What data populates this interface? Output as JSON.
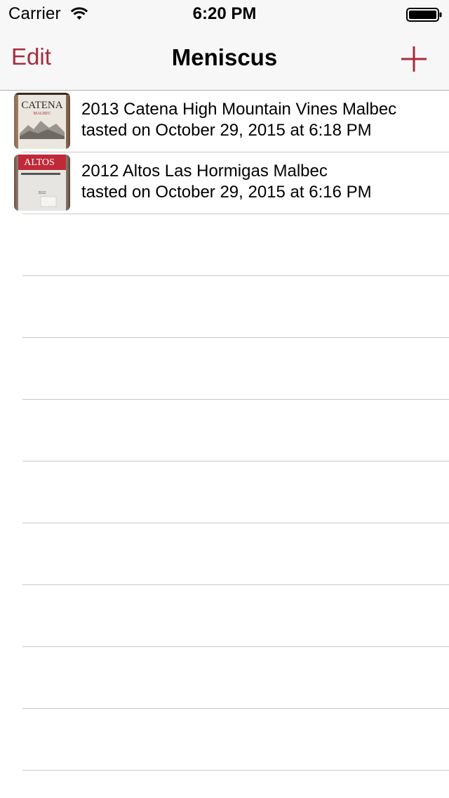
{
  "status_bar": {
    "carrier": "Carrier",
    "time": "6:20 PM",
    "wifi_icon": "wifi-icon",
    "battery_icon": "battery-icon"
  },
  "nav": {
    "edit_label": "Edit",
    "title": "Meniscus",
    "add_icon": "plus-icon"
  },
  "colors": {
    "accent": "#a82b3d",
    "separator": "#c8c7cc",
    "nav_background": "#f7f7f7"
  },
  "tastings": [
    {
      "title": "2013 Catena High Mountain Vines Malbec",
      "subtitle": "tasted on October 29, 2015 at 6:18 PM",
      "thumbnail_icon": "wine-bottle-photo",
      "label_text": "CATENA",
      "label_subtext": "MALBEC"
    },
    {
      "title": "2012 Altos Las Hormigas Malbec",
      "subtitle": "tasted on October 29, 2015 at 6:16 PM",
      "thumbnail_icon": "wine-bottle-photo",
      "label_text": "ALTOS",
      "label_subtext": "2012"
    }
  ]
}
